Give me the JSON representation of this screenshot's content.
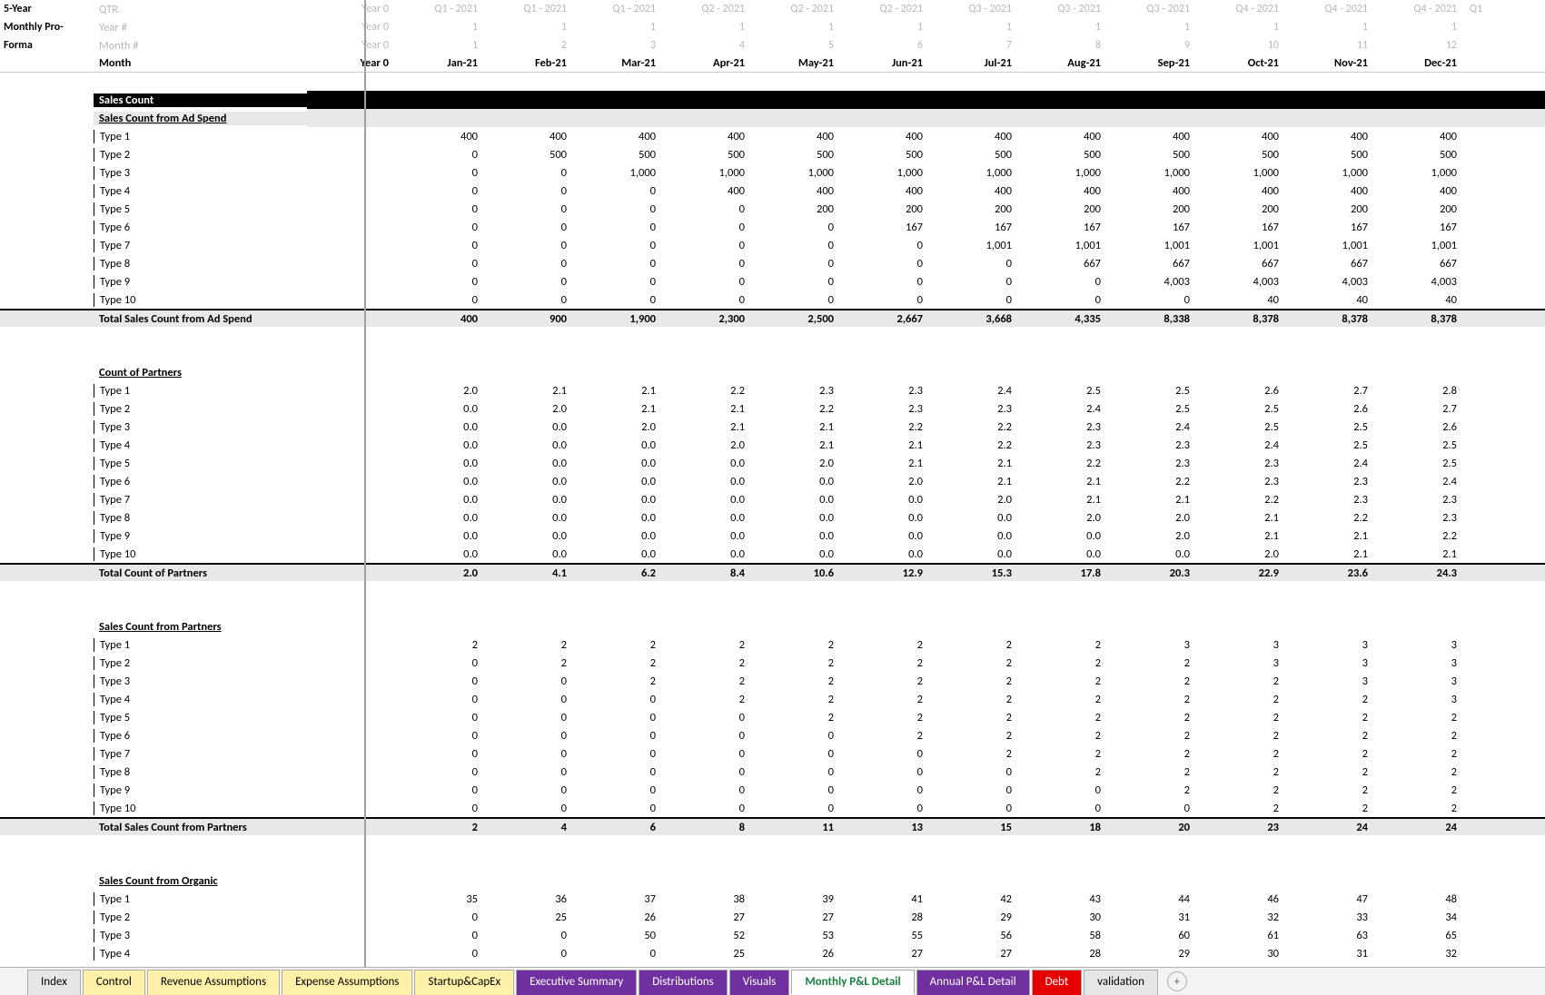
{
  "side": {
    "l1": "5-Year",
    "l2": "Monthly Pro-",
    "l3": "Forma"
  },
  "ghost": {
    "qtr": "QTR.",
    "yr": "Year #",
    "mn": "Month #"
  },
  "year0": "Year 0",
  "months": [
    "Jan-21",
    "Feb-21",
    "Mar-21",
    "Apr-21",
    "May-21",
    "Jun-21",
    "Jul-21",
    "Aug-21",
    "Sep-21",
    "Oct-21",
    "Nov-21",
    "Dec-21"
  ],
  "qtrs": [
    "Q1 - 2021",
    "Q1 - 2021",
    "Q1 - 2021",
    "Q2 - 2021",
    "Q2 - 2021",
    "Q2 - 2021",
    "Q3 - 2021",
    "Q3 - 2021",
    "Q3 - 2021",
    "Q4 - 2021",
    "Q4 - 2021",
    "Q4 - 2021"
  ],
  "yearrow": [
    "Year 0",
    "1",
    "1",
    "1",
    "1",
    "1",
    "1",
    "1",
    "1",
    "1",
    "1",
    "1",
    "1"
  ],
  "monthnum": [
    "Year 0",
    "1",
    "2",
    "3",
    "4",
    "5",
    "6",
    "7",
    "8",
    "9",
    "10",
    "11",
    "12"
  ],
  "monthlabel": "Month",
  "peekQtr": "Q1",
  "sec1": {
    "title": "Sales Count",
    "sub": "Sales Count from Ad Spend"
  },
  "types": [
    "Type 1",
    "Type 2",
    "Type 3",
    "Type 4",
    "Type 5",
    "Type 6",
    "Type 7",
    "Type 8",
    "Type 9",
    "Type 10"
  ],
  "adSpend": [
    [
      "400",
      "400",
      "400",
      "400",
      "400",
      "400",
      "400",
      "400",
      "400",
      "400",
      "400",
      "400"
    ],
    [
      "0",
      "500",
      "500",
      "500",
      "500",
      "500",
      "500",
      "500",
      "500",
      "500",
      "500",
      "500"
    ],
    [
      "0",
      "0",
      "1,000",
      "1,000",
      "1,000",
      "1,000",
      "1,000",
      "1,000",
      "1,000",
      "1,000",
      "1,000",
      "1,000"
    ],
    [
      "0",
      "0",
      "0",
      "400",
      "400",
      "400",
      "400",
      "400",
      "400",
      "400",
      "400",
      "400"
    ],
    [
      "0",
      "0",
      "0",
      "0",
      "200",
      "200",
      "200",
      "200",
      "200",
      "200",
      "200",
      "200"
    ],
    [
      "0",
      "0",
      "0",
      "0",
      "0",
      "167",
      "167",
      "167",
      "167",
      "167",
      "167",
      "167"
    ],
    [
      "0",
      "0",
      "0",
      "0",
      "0",
      "0",
      "1,001",
      "1,001",
      "1,001",
      "1,001",
      "1,001",
      "1,001"
    ],
    [
      "0",
      "0",
      "0",
      "0",
      "0",
      "0",
      "0",
      "667",
      "667",
      "667",
      "667",
      "667"
    ],
    [
      "0",
      "0",
      "0",
      "0",
      "0",
      "0",
      "0",
      "0",
      "4,003",
      "4,003",
      "4,003",
      "4,003"
    ],
    [
      "0",
      "0",
      "0",
      "0",
      "0",
      "0",
      "0",
      "0",
      "0",
      "40",
      "40",
      "40"
    ]
  ],
  "adTotalLabel": "Total Sales Count from Ad Spend",
  "adTotal": [
    "400",
    "900",
    "1,900",
    "2,300",
    "2,500",
    "2,667",
    "3,668",
    "4,335",
    "8,338",
    "8,378",
    "8,378",
    "8,378"
  ],
  "sec2": "Count of Partners",
  "partnersCount": [
    [
      "2.0",
      "2.1",
      "2.1",
      "2.2",
      "2.3",
      "2.3",
      "2.4",
      "2.5",
      "2.5",
      "2.6",
      "2.7",
      "2.8"
    ],
    [
      "0.0",
      "2.0",
      "2.1",
      "2.1",
      "2.2",
      "2.3",
      "2.3",
      "2.4",
      "2.5",
      "2.5",
      "2.6",
      "2.7"
    ],
    [
      "0.0",
      "0.0",
      "2.0",
      "2.1",
      "2.1",
      "2.2",
      "2.2",
      "2.3",
      "2.4",
      "2.5",
      "2.5",
      "2.6"
    ],
    [
      "0.0",
      "0.0",
      "0.0",
      "2.0",
      "2.1",
      "2.1",
      "2.2",
      "2.3",
      "2.3",
      "2.4",
      "2.5",
      "2.5"
    ],
    [
      "0.0",
      "0.0",
      "0.0",
      "0.0",
      "2.0",
      "2.1",
      "2.1",
      "2.2",
      "2.3",
      "2.3",
      "2.4",
      "2.5"
    ],
    [
      "0.0",
      "0.0",
      "0.0",
      "0.0",
      "0.0",
      "2.0",
      "2.1",
      "2.1",
      "2.2",
      "2.3",
      "2.3",
      "2.4"
    ],
    [
      "0.0",
      "0.0",
      "0.0",
      "0.0",
      "0.0",
      "0.0",
      "2.0",
      "2.1",
      "2.1",
      "2.2",
      "2.3",
      "2.3"
    ],
    [
      "0.0",
      "0.0",
      "0.0",
      "0.0",
      "0.0",
      "0.0",
      "0.0",
      "2.0",
      "2.0",
      "2.1",
      "2.2",
      "2.3"
    ],
    [
      "0.0",
      "0.0",
      "0.0",
      "0.0",
      "0.0",
      "0.0",
      "0.0",
      "0.0",
      "2.0",
      "2.1",
      "2.1",
      "2.2"
    ],
    [
      "0.0",
      "0.0",
      "0.0",
      "0.0",
      "0.0",
      "0.0",
      "0.0",
      "0.0",
      "0.0",
      "2.0",
      "2.1",
      "2.1"
    ]
  ],
  "partnersTotalLabel": "Total Count of Partners",
  "partnersTotal": [
    "2.0",
    "4.1",
    "6.2",
    "8.4",
    "10.6",
    "12.9",
    "15.3",
    "17.8",
    "20.3",
    "22.9",
    "23.6",
    "24.3"
  ],
  "sec3": "Sales Count from Partners",
  "fromPartners": [
    [
      "2",
      "2",
      "2",
      "2",
      "2",
      "2",
      "2",
      "2",
      "3",
      "3",
      "3",
      "3"
    ],
    [
      "0",
      "2",
      "2",
      "2",
      "2",
      "2",
      "2",
      "2",
      "2",
      "3",
      "3",
      "3"
    ],
    [
      "0",
      "0",
      "2",
      "2",
      "2",
      "2",
      "2",
      "2",
      "2",
      "2",
      "3",
      "3"
    ],
    [
      "0",
      "0",
      "0",
      "2",
      "2",
      "2",
      "2",
      "2",
      "2",
      "2",
      "2",
      "3"
    ],
    [
      "0",
      "0",
      "0",
      "0",
      "2",
      "2",
      "2",
      "2",
      "2",
      "2",
      "2",
      "2"
    ],
    [
      "0",
      "0",
      "0",
      "0",
      "0",
      "2",
      "2",
      "2",
      "2",
      "2",
      "2",
      "2"
    ],
    [
      "0",
      "0",
      "0",
      "0",
      "0",
      "0",
      "2",
      "2",
      "2",
      "2",
      "2",
      "2"
    ],
    [
      "0",
      "0",
      "0",
      "0",
      "0",
      "0",
      "0",
      "2",
      "2",
      "2",
      "2",
      "2"
    ],
    [
      "0",
      "0",
      "0",
      "0",
      "0",
      "0",
      "0",
      "0",
      "2",
      "2",
      "2",
      "2"
    ],
    [
      "0",
      "0",
      "0",
      "0",
      "0",
      "0",
      "0",
      "0",
      "0",
      "2",
      "2",
      "2"
    ]
  ],
  "fromPartnersTotalLabel": "Total Sales Count from Partners",
  "fromPartnersTotal": [
    "2",
    "4",
    "6",
    "8",
    "11",
    "13",
    "15",
    "18",
    "20",
    "23",
    "24",
    "24"
  ],
  "sec4": "Sales Count from Organic",
  "organic": [
    [
      "35",
      "36",
      "37",
      "38",
      "39",
      "41",
      "42",
      "43",
      "44",
      "46",
      "47",
      "48"
    ],
    [
      "0",
      "25",
      "26",
      "27",
      "27",
      "28",
      "29",
      "30",
      "31",
      "32",
      "33",
      "34"
    ],
    [
      "0",
      "0",
      "50",
      "52",
      "53",
      "55",
      "56",
      "58",
      "60",
      "61",
      "63",
      "65"
    ],
    [
      "0",
      "0",
      "0",
      "25",
      "26",
      "27",
      "27",
      "28",
      "29",
      "30",
      "31",
      "32"
    ]
  ],
  "tabs": [
    {
      "label": "Index",
      "cls": ""
    },
    {
      "label": "Control",
      "cls": "yellow"
    },
    {
      "label": "Revenue Assumptions",
      "cls": "yellow"
    },
    {
      "label": "Expense Assumptions",
      "cls": "yellow"
    },
    {
      "label": "Startup&CapEx",
      "cls": "yellow"
    },
    {
      "label": "Executive Summary",
      "cls": "purple"
    },
    {
      "label": "Distributions",
      "cls": "purple"
    },
    {
      "label": "Visuals",
      "cls": "purple"
    },
    {
      "label": "Monthly P&L Detail",
      "cls": "green"
    },
    {
      "label": "Annual P&L Detail",
      "cls": "darkpurple"
    },
    {
      "label": "Debt",
      "cls": "red"
    },
    {
      "label": "validation",
      "cls": ""
    }
  ]
}
